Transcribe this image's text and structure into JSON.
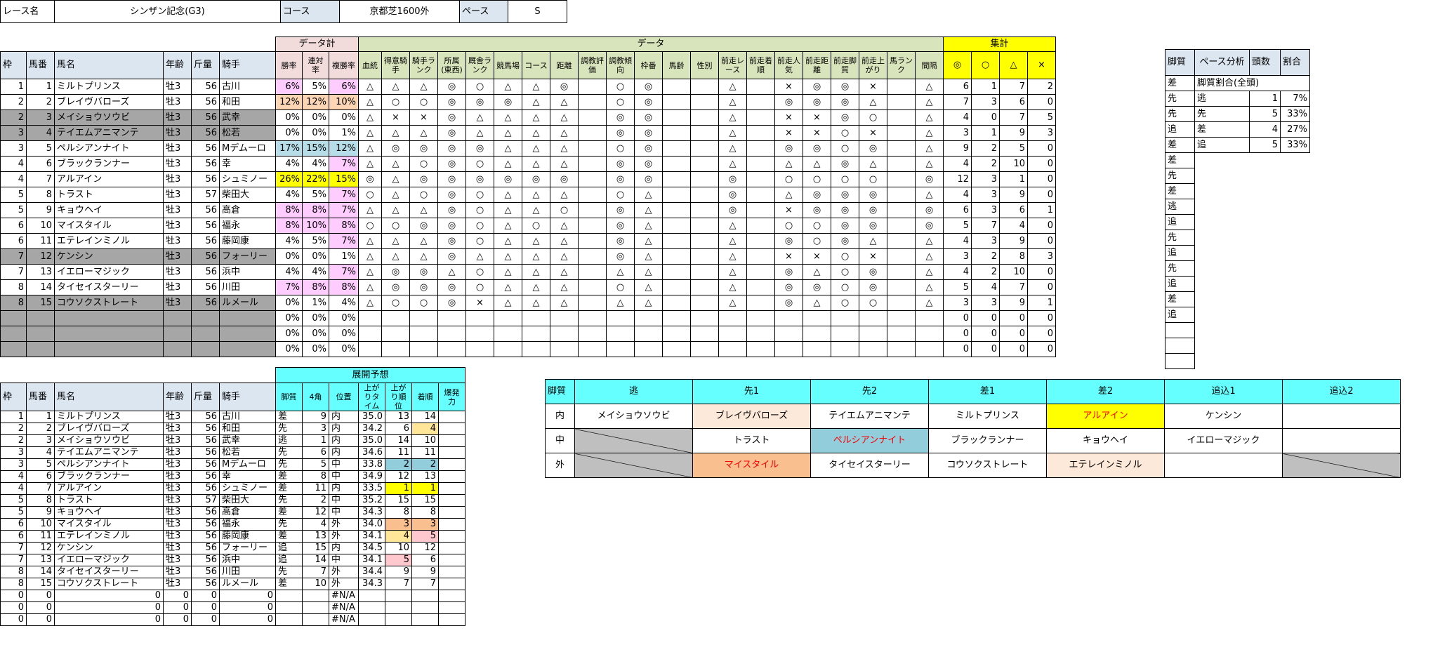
{
  "header": {
    "race_label": "レース名",
    "race_name": "シンザン記念(G3)",
    "course_label": "コース",
    "course": "京都芝1600外",
    "pace_label": "ペース",
    "pace": "S"
  },
  "main_headers": {
    "group_datakei": "データ計",
    "group_data": "データ",
    "group_shukei": "集計",
    "waku": "枠",
    "umaban": "馬番",
    "bamei": "馬名",
    "nenrei": "年齢",
    "kinryo": "斤量",
    "kishu": "騎手",
    "win": "勝率",
    "ren": "連対率",
    "fuku": "複勝率",
    "data_cols": [
      "血統",
      "得意騎手",
      "騎手ランク",
      "所属(東西)",
      "厩舎ランク",
      "競馬場",
      "コース",
      "距離",
      "調教評価",
      "調教傾向",
      "枠番",
      "馬齢",
      "性別",
      "前走レース",
      "前走着順",
      "前走人気",
      "前走距離",
      "前走脚質",
      "前走上がり",
      "馬ランク",
      "間隔"
    ],
    "shukei_cols": [
      "◎",
      "○",
      "△",
      "×"
    ]
  },
  "horses": [
    {
      "waku": "1",
      "umaban": "1",
      "name": "ミルトプリンス",
      "age": "牡3",
      "kin": "56",
      "jockey": "古川",
      "win": "6%",
      "ren": "5%",
      "fuku": "6%",
      "d": [
        "△",
        "△",
        "△",
        "◎",
        "○",
        "△",
        "△",
        "◎",
        "",
        "○",
        "◎",
        "",
        "",
        "△",
        "",
        "×",
        "◎",
        "◎",
        "×",
        "",
        "△"
      ],
      "s": [
        "6",
        "1",
        "7",
        "2"
      ]
    },
    {
      "waku": "2",
      "umaban": "2",
      "name": "ブレイヴバローズ",
      "age": "牡3",
      "kin": "56",
      "jockey": "和田",
      "win": "12%",
      "ren": "12%",
      "fuku": "10%",
      "d": [
        "△",
        "○",
        "○",
        "◎",
        "◎",
        "◎",
        "△",
        "△",
        "",
        "○",
        "◎",
        "",
        "",
        "△",
        "",
        "◎",
        "◎",
        "◎",
        "△",
        "",
        "△"
      ],
      "s": [
        "7",
        "3",
        "6",
        "0"
      ]
    },
    {
      "waku": "2",
      "umaban": "3",
      "name": "メイショウソウビ",
      "age": "牡3",
      "kin": "56",
      "jockey": "武幸",
      "win": "0%",
      "ren": "0%",
      "fuku": "0%",
      "d": [
        "△",
        "×",
        "×",
        "◎",
        "△",
        "△",
        "△",
        "△",
        "",
        "◎",
        "◎",
        "",
        "",
        "△",
        "",
        "×",
        "×",
        "◎",
        "○",
        "",
        "△"
      ],
      "s": [
        "4",
        "0",
        "7",
        "5"
      ]
    },
    {
      "waku": "3",
      "umaban": "4",
      "name": "テイエムアニマンテ",
      "age": "牡3",
      "kin": "56",
      "jockey": "松若",
      "win": "0%",
      "ren": "0%",
      "fuku": "1%",
      "d": [
        "△",
        "△",
        "△",
        "◎",
        "△",
        "△",
        "△",
        "△",
        "",
        "◎",
        "◎",
        "",
        "",
        "△",
        "",
        "×",
        "×",
        "○",
        "×",
        "",
        "△"
      ],
      "s": [
        "3",
        "1",
        "9",
        "3"
      ]
    },
    {
      "waku": "3",
      "umaban": "5",
      "name": "ペルシアンナイト",
      "age": "牡3",
      "kin": "56",
      "jockey": "Mデムーロ",
      "win": "17%",
      "ren": "15%",
      "fuku": "12%",
      "d": [
        "△",
        "◎",
        "◎",
        "◎",
        "◎",
        "△",
        "△",
        "△",
        "",
        "○",
        "◎",
        "",
        "",
        "△",
        "",
        "◎",
        "◎",
        "○",
        "◎",
        "",
        "△"
      ],
      "s": [
        "9",
        "2",
        "5",
        "0"
      ]
    },
    {
      "waku": "4",
      "umaban": "6",
      "name": "ブラックランナー",
      "age": "牡3",
      "kin": "56",
      "jockey": "幸",
      "win": "4%",
      "ren": "4%",
      "fuku": "7%",
      "d": [
        "△",
        "△",
        "○",
        "◎",
        "○",
        "△",
        "△",
        "△",
        "",
        "◎",
        "◎",
        "",
        "",
        "△",
        "",
        "△",
        "△",
        "◎",
        "△",
        "",
        "△"
      ],
      "s": [
        "4",
        "2",
        "10",
        "0"
      ]
    },
    {
      "waku": "4",
      "umaban": "7",
      "name": "アルアイン",
      "age": "牡3",
      "kin": "56",
      "jockey": "シュミノー",
      "win": "26%",
      "ren": "22%",
      "fuku": "15%",
      "d": [
        "◎",
        "△",
        "◎",
        "◎",
        "◎",
        "◎",
        "◎",
        "◎",
        "",
        "◎",
        "◎",
        "",
        "",
        "◎",
        "",
        "○",
        "○",
        "○",
        "○",
        "",
        "◎"
      ],
      "s": [
        "12",
        "3",
        "1",
        "0"
      ]
    },
    {
      "waku": "5",
      "umaban": "8",
      "name": "トラスト",
      "age": "牡3",
      "kin": "57",
      "jockey": "柴田大",
      "win": "4%",
      "ren": "5%",
      "fuku": "7%",
      "d": [
        "○",
        "△",
        "○",
        "◎",
        "○",
        "△",
        "△",
        "△",
        "",
        "○",
        "△",
        "",
        "",
        "◎",
        "",
        "△",
        "◎",
        "◎",
        "◎",
        "",
        "△"
      ],
      "s": [
        "4",
        "3",
        "9",
        "0"
      ]
    },
    {
      "waku": "5",
      "umaban": "9",
      "name": "キョウヘイ",
      "age": "牡3",
      "kin": "56",
      "jockey": "高倉",
      "win": "8%",
      "ren": "8%",
      "fuku": "7%",
      "d": [
        "△",
        "△",
        "△",
        "◎",
        "○",
        "△",
        "△",
        "○",
        "",
        "◎",
        "△",
        "",
        "",
        "◎",
        "",
        "×",
        "◎",
        "◎",
        "◎",
        "",
        "◎"
      ],
      "s": [
        "6",
        "3",
        "6",
        "1"
      ]
    },
    {
      "waku": "6",
      "umaban": "10",
      "name": "マイスタイル",
      "age": "牡3",
      "kin": "56",
      "jockey": "福永",
      "win": "8%",
      "ren": "10%",
      "fuku": "8%",
      "d": [
        "○",
        "○",
        "◎",
        "◎",
        "○",
        "△",
        "○",
        "△",
        "",
        "◎",
        "△",
        "",
        "",
        "△",
        "",
        "○",
        "○",
        "◎",
        "◎",
        "",
        "◎"
      ],
      "s": [
        "5",
        "7",
        "4",
        "0"
      ]
    },
    {
      "waku": "6",
      "umaban": "11",
      "name": "エテレインミノル",
      "age": "牡3",
      "kin": "56",
      "jockey": "藤岡康",
      "win": "4%",
      "ren": "5%",
      "fuku": "7%",
      "d": [
        "△",
        "△",
        "△",
        "◎",
        "○",
        "△",
        "△",
        "△",
        "",
        "◎",
        "△",
        "",
        "",
        "△",
        "",
        "◎",
        "○",
        "◎",
        "△",
        "",
        "△"
      ],
      "s": [
        "4",
        "3",
        "9",
        "0"
      ]
    },
    {
      "waku": "7",
      "umaban": "12",
      "name": "ケンシン",
      "age": "牡3",
      "kin": "56",
      "jockey": "フォーリー",
      "win": "0%",
      "ren": "0%",
      "fuku": "1%",
      "d": [
        "△",
        "△",
        "△",
        "◎",
        "△",
        "△",
        "△",
        "△",
        "",
        "◎",
        "△",
        "",
        "",
        "△",
        "",
        "×",
        "×",
        "○",
        "×",
        "",
        "△"
      ],
      "s": [
        "3",
        "2",
        "8",
        "3"
      ]
    },
    {
      "waku": "7",
      "umaban": "13",
      "name": "イエローマジック",
      "age": "牡3",
      "kin": "56",
      "jockey": "浜中",
      "win": "4%",
      "ren": "4%",
      "fuku": "7%",
      "d": [
        "△",
        "◎",
        "◎",
        "△",
        "○",
        "△",
        "△",
        "△",
        "",
        "△",
        "△",
        "",
        "",
        "△",
        "",
        "◎",
        "△",
        "○",
        "◎",
        "",
        "△"
      ],
      "s": [
        "4",
        "2",
        "10",
        "0"
      ]
    },
    {
      "waku": "8",
      "umaban": "14",
      "name": "タイセイスターリー",
      "age": "牡3",
      "kin": "56",
      "jockey": "川田",
      "win": "7%",
      "ren": "8%",
      "fuku": "8%",
      "d": [
        "△",
        "◎",
        "◎",
        "◎",
        "○",
        "△",
        "△",
        "△",
        "",
        "○",
        "△",
        "",
        "",
        "△",
        "",
        "◎",
        "◎",
        "○",
        "◎",
        "",
        "△"
      ],
      "s": [
        "5",
        "4",
        "7",
        "0"
      ]
    },
    {
      "waku": "8",
      "umaban": "15",
      "name": "コウソクストレート",
      "age": "牡3",
      "kin": "56",
      "jockey": "ルメール",
      "win": "0%",
      "ren": "1%",
      "fuku": "4%",
      "d": [
        "△",
        "○",
        "○",
        "◎",
        "×",
        "△",
        "△",
        "△",
        "",
        "△",
        "△",
        "",
        "",
        "△",
        "",
        "◎",
        "△",
        "○",
        "○",
        "",
        "△"
      ],
      "s": [
        "3",
        "3",
        "9",
        "1"
      ]
    },
    {
      "waku": "",
      "umaban": "",
      "name": "",
      "age": "",
      "kin": "",
      "jockey": "",
      "win": "0%",
      "ren": "0%",
      "fuku": "0%",
      "d": [
        "",
        "",
        "",
        "",
        "",
        "",
        "",
        "",
        "",
        "",
        "",
        "",
        "",
        "",
        "",
        "",
        "",
        "",
        "",
        "",
        ""
      ],
      "s": [
        "0",
        "0",
        "0",
        "0"
      ]
    },
    {
      "waku": "",
      "umaban": "",
      "name": "",
      "age": "",
      "kin": "",
      "jockey": "",
      "win": "0%",
      "ren": "0%",
      "fuku": "0%",
      "d": [
        "",
        "",
        "",
        "",
        "",
        "",
        "",
        "",
        "",
        "",
        "",
        "",
        "",
        "",
        "",
        "",
        "",
        "",
        "",
        "",
        ""
      ],
      "s": [
        "0",
        "0",
        "0",
        "0"
      ]
    },
    {
      "waku": "",
      "umaban": "",
      "name": "",
      "age": "",
      "kin": "",
      "jockey": "",
      "win": "0%",
      "ren": "0%",
      "fuku": "0%",
      "d": [
        "",
        "",
        "",
        "",
        "",
        "",
        "",
        "",
        "",
        "",
        "",
        "",
        "",
        "",
        "",
        "",
        "",
        "",
        "",
        "",
        ""
      ],
      "s": [
        "0",
        "0",
        "0",
        "0"
      ]
    }
  ],
  "kyakushitsu": {
    "head": "脚質",
    "list": [
      "差",
      "先",
      "先",
      "追",
      "差",
      "差",
      "先",
      "差",
      "逃",
      "追",
      "先",
      "追",
      "先",
      "追",
      "差",
      "追",
      "",
      "",
      ""
    ],
    "pace_head": "ペース分析",
    "count_head": "頭数",
    "ratio_head": "割合",
    "sub_title": "脚質割合(全頭)",
    "rows": [
      {
        "k": "逃",
        "n": "1",
        "p": "7%"
      },
      {
        "k": "先",
        "n": "5",
        "p": "33%"
      },
      {
        "k": "差",
        "n": "4",
        "p": "27%"
      },
      {
        "k": "追",
        "n": "5",
        "p": "33%"
      }
    ]
  },
  "tenkai": {
    "group": "展開予想",
    "kyaku": "脚質",
    "yon": "4角",
    "ichi": "位置",
    "agari_time": "上がりタイム",
    "agari_rank": "上がり順位",
    "chaku": "着順",
    "bakuhatsu": "爆発力",
    "rows": [
      {
        "waku": "1",
        "umaban": "1",
        "name": "ミルトプリンス",
        "age": "牡3",
        "kin": "56",
        "jockey": "古川",
        "k": "差",
        "y": "9",
        "i": "内",
        "t": "35.0",
        "ar": "13",
        "c": "14"
      },
      {
        "waku": "2",
        "umaban": "2",
        "name": "ブレイヴバローズ",
        "age": "牡3",
        "kin": "56",
        "jockey": "和田",
        "k": "先",
        "y": "3",
        "i": "内",
        "t": "34.2",
        "ar": "6",
        "c": "4"
      },
      {
        "waku": "2",
        "umaban": "3",
        "name": "メイショウソウビ",
        "age": "牡3",
        "kin": "56",
        "jockey": "武幸",
        "k": "逃",
        "y": "1",
        "i": "内",
        "t": "35.0",
        "ar": "14",
        "c": "10"
      },
      {
        "waku": "3",
        "umaban": "4",
        "name": "テイエムアニマンテ",
        "age": "牡3",
        "kin": "56",
        "jockey": "松若",
        "k": "先",
        "y": "6",
        "i": "内",
        "t": "34.6",
        "ar": "11",
        "c": "11"
      },
      {
        "waku": "3",
        "umaban": "5",
        "name": "ペルシアンナイト",
        "age": "牡3",
        "kin": "56",
        "jockey": "Mデムーロ",
        "k": "先",
        "y": "5",
        "i": "中",
        "t": "33.8",
        "ar": "2",
        "c": "2"
      },
      {
        "waku": "4",
        "umaban": "6",
        "name": "ブラックランナー",
        "age": "牡3",
        "kin": "56",
        "jockey": "幸",
        "k": "差",
        "y": "8",
        "i": "中",
        "t": "34.9",
        "ar": "12",
        "c": "13"
      },
      {
        "waku": "4",
        "umaban": "7",
        "name": "アルアイン",
        "age": "牡3",
        "kin": "56",
        "jockey": "シュミノー",
        "k": "差",
        "y": "11",
        "i": "内",
        "t": "33.5",
        "ar": "1",
        "c": "1"
      },
      {
        "waku": "5",
        "umaban": "8",
        "name": "トラスト",
        "age": "牡3",
        "kin": "57",
        "jockey": "柴田大",
        "k": "先",
        "y": "2",
        "i": "中",
        "t": "35.2",
        "ar": "15",
        "c": "15"
      },
      {
        "waku": "5",
        "umaban": "9",
        "name": "キョウヘイ",
        "age": "牡3",
        "kin": "56",
        "jockey": "高倉",
        "k": "差",
        "y": "12",
        "i": "中",
        "t": "34.3",
        "ar": "8",
        "c": "8"
      },
      {
        "waku": "6",
        "umaban": "10",
        "name": "マイスタイル",
        "age": "牡3",
        "kin": "56",
        "jockey": "福永",
        "k": "先",
        "y": "4",
        "i": "外",
        "t": "34.0",
        "ar": "3",
        "c": "3"
      },
      {
        "waku": "6",
        "umaban": "11",
        "name": "エテレインミノル",
        "age": "牡3",
        "kin": "56",
        "jockey": "藤岡康",
        "k": "差",
        "y": "13",
        "i": "外",
        "t": "34.1",
        "ar": "4",
        "c": "5"
      },
      {
        "waku": "7",
        "umaban": "12",
        "name": "ケンシン",
        "age": "牡3",
        "kin": "56",
        "jockey": "フォーリー",
        "k": "追",
        "y": "15",
        "i": "内",
        "t": "34.5",
        "ar": "10",
        "c": "12"
      },
      {
        "waku": "7",
        "umaban": "13",
        "name": "イエローマジック",
        "age": "牡3",
        "kin": "56",
        "jockey": "浜中",
        "k": "追",
        "y": "14",
        "i": "中",
        "t": "34.1",
        "ar": "5",
        "c": "6"
      },
      {
        "waku": "8",
        "umaban": "14",
        "name": "タイセイスターリー",
        "age": "牡3",
        "kin": "56",
        "jockey": "川田",
        "k": "先",
        "y": "7",
        "i": "外",
        "t": "34.4",
        "ar": "9",
        "c": "9"
      },
      {
        "waku": "8",
        "umaban": "15",
        "name": "コウソクストレート",
        "age": "牡3",
        "kin": "56",
        "jockey": "ルメール",
        "k": "差",
        "y": "10",
        "i": "外",
        "t": "34.3",
        "ar": "7",
        "c": "7"
      },
      {
        "waku": "0",
        "umaban": "0",
        "name": "0",
        "age": "0",
        "kin": "0",
        "jockey": "0",
        "k": "",
        "y": "",
        "i": "#N/A",
        "t": "",
        "ar": "",
        "c": ""
      },
      {
        "waku": "0",
        "umaban": "0",
        "name": "0",
        "age": "0",
        "kin": "0",
        "jockey": "0",
        "k": "",
        "y": "",
        "i": "#N/A",
        "t": "",
        "ar": "",
        "c": ""
      },
      {
        "waku": "0",
        "umaban": "0",
        "name": "0",
        "age": "0",
        "kin": "0",
        "jockey": "0",
        "k": "",
        "y": "",
        "i": "#N/A",
        "t": "",
        "ar": "",
        "c": ""
      }
    ]
  },
  "position_map": {
    "head": "脚質",
    "cols": [
      "逃",
      "先1",
      "先2",
      "差1",
      "差2",
      "追込1",
      "追込2"
    ],
    "rows": [
      {
        "label": "内",
        "cells": [
          "メイショウソウビ",
          "ブレイヴバローズ",
          "テイエムアニマンテ",
          "ミルトプリンス",
          "アルアイン",
          "ケンシン",
          ""
        ]
      },
      {
        "label": "中",
        "cells": [
          "",
          "トラスト",
          "ペルシアンナイト",
          "ブラックランナー",
          "キョウヘイ",
          "イエローマジック",
          ""
        ]
      },
      {
        "label": "外",
        "cells": [
          "",
          "マイスタイル",
          "タイセイスターリー",
          "コウソクストレート",
          "エテレインミノル",
          "",
          ""
        ]
      }
    ]
  },
  "colors": {
    "pink": "#ffccff",
    "peach": "#fcd5b4",
    "blue": "#b7dee8",
    "yellow": "#ffff00",
    "cyan": "#66ffff",
    "gray": "#a6a6a6"
  }
}
